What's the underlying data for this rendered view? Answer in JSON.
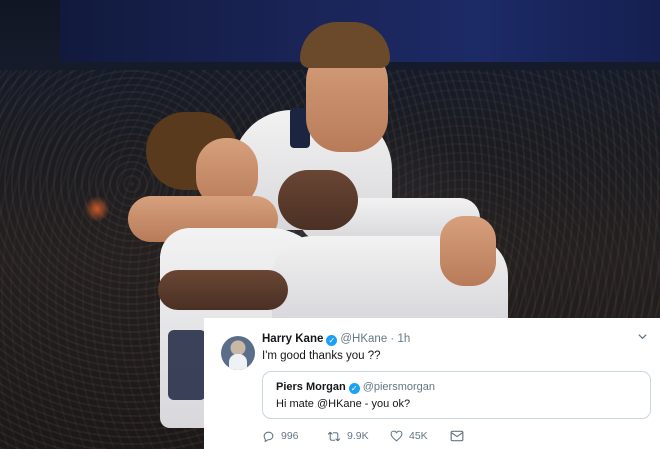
{
  "tweet": {
    "author_name": "Harry Kane",
    "author_handle": "@HKane",
    "separator": "·",
    "time": "1h",
    "text": "I'm good thanks you ??",
    "quoted": {
      "author_name": "Piers Morgan",
      "author_handle": "@piersmorgan",
      "text": "Hi mate @HKane - you ok?"
    },
    "actions": {
      "replies": "996",
      "retweets": "9.9K",
      "likes": "45K"
    },
    "icons": {
      "verified": "verified-badge-icon",
      "menu": "chevron-down-icon",
      "reply": "reply-icon",
      "retweet": "retweet-icon",
      "like": "heart-icon",
      "dm": "envelope-icon"
    }
  },
  "colors": {
    "verified": "#1da1f2",
    "secondary_text": "#657786",
    "border": "#ccd6dd"
  }
}
